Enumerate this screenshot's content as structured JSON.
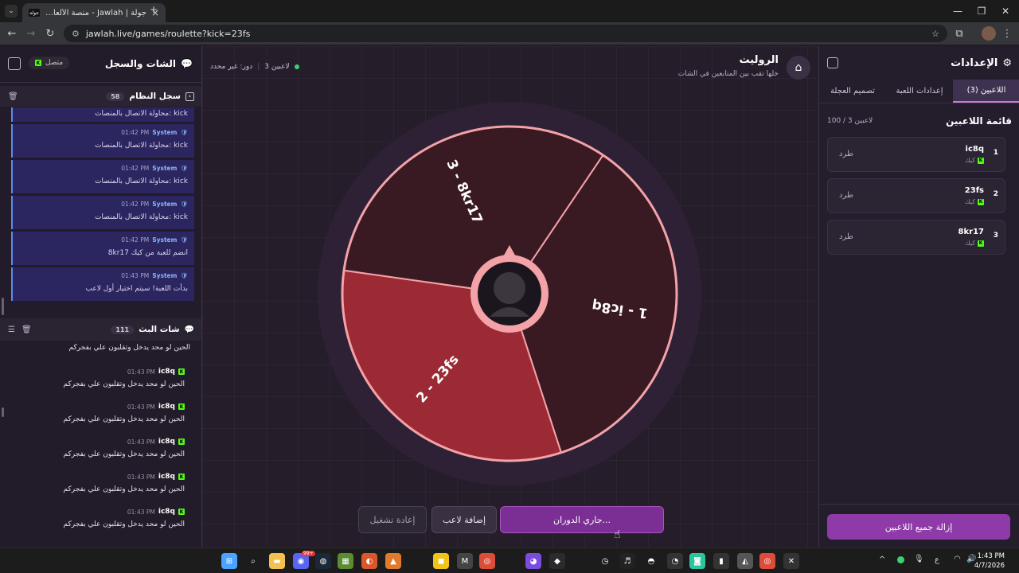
{
  "browser": {
    "tab_title": "جولة | Jawlah - منصة الألعاب الت...",
    "tab_favicon": "جولة",
    "url": "jawlah.live/games/roulette?kick=23fs"
  },
  "settings": {
    "title": "الإعدادات",
    "tabs": [
      "اللاعبين (3)",
      "إعدادات اللعبة",
      "تصميم العجلة"
    ],
    "list_title": "قائمة اللاعبين",
    "count": "100 / 3 لاعبين",
    "players": [
      {
        "index": "1",
        "name": "ic8q",
        "platform": "كيك",
        "action": "طرد"
      },
      {
        "index": "2",
        "name": "23fs",
        "platform": "كيك",
        "action": "طرد"
      },
      {
        "index": "3",
        "name": "8kr17",
        "platform": "كيك",
        "action": "طرد"
      }
    ],
    "remove_all": "إزالة جميع اللاعبين"
  },
  "chat": {
    "title": "الشات والسجل",
    "status": "متصل",
    "system_log": {
      "title": "سجل النظام",
      "count": "58",
      "partial_text": "محاولة الاتصال بالمنصات: kick",
      "messages": [
        {
          "name": "System",
          "time": "01:42 PM",
          "text": "محاولة الاتصال بالمنصات: kick"
        },
        {
          "name": "System",
          "time": "01:42 PM",
          "text": "محاولة الاتصال بالمنصات: kick"
        },
        {
          "name": "System",
          "time": "01:42 PM",
          "text": "محاولة الاتصال بالمنصات: kick"
        },
        {
          "name": "System",
          "time": "01:42 PM",
          "text": "8kr17 انضم للعبة من كيك"
        },
        {
          "name": "System",
          "time": "01:43 PM",
          "text": "بدأت اللعبة! سيتم اختيار أول لاعب"
        }
      ]
    },
    "stream_chat": {
      "title": "شات البث",
      "count": "111",
      "partial_text": "الحين لو محد يدخل وتقلبون علي بفجركم",
      "messages": [
        {
          "name": "ic8q",
          "time": "01:43 PM",
          "text": "الحين لو محد يدخل وتقلبون علي بفجركم"
        },
        {
          "name": "ic8q",
          "time": "01:43 PM",
          "text": "الحين لو محد يدخل وتقلبون علي بفجركم"
        },
        {
          "name": "ic8q",
          "time": "01:43 PM",
          "text": "الحين لو محد يدخل وتقلبون علي بفجركم"
        },
        {
          "name": "ic8q",
          "time": "01:43 PM",
          "text": "الحين لو محد يدخل وتقلبون علي بفجركم"
        },
        {
          "name": "ic8q",
          "time": "01:43 PM",
          "text": "الحين لو محد يدخل وتقلبون علي بفجركم"
        }
      ]
    }
  },
  "main": {
    "title": "الروليت",
    "subtitle": "خلها تقب بين المتابعين في الشات",
    "players_count": "3 لاعبين",
    "turn": "دور: غير محدد",
    "wheel": {
      "segments": [
        {
          "label": "1 - ic8q",
          "color": "#3a1a22"
        },
        {
          "label": "2 - 23fs",
          "color": "#9c2a35"
        },
        {
          "label": "3 - 8kr17",
          "color": "#3a1a22"
        }
      ],
      "rim_color": "#f3a2a8"
    },
    "buttons": {
      "spin": "جاري الدوران...",
      "add": "إضافة لاعب",
      "restart": "إعادة تشغيل"
    }
  },
  "taskbar": {
    "time": "1:43 PM",
    "date": "4/7/2026",
    "lang": "ع",
    "discord_badge": "99+"
  },
  "colors": {
    "accent": "#8e3aa8",
    "kick": "#53fc18"
  }
}
